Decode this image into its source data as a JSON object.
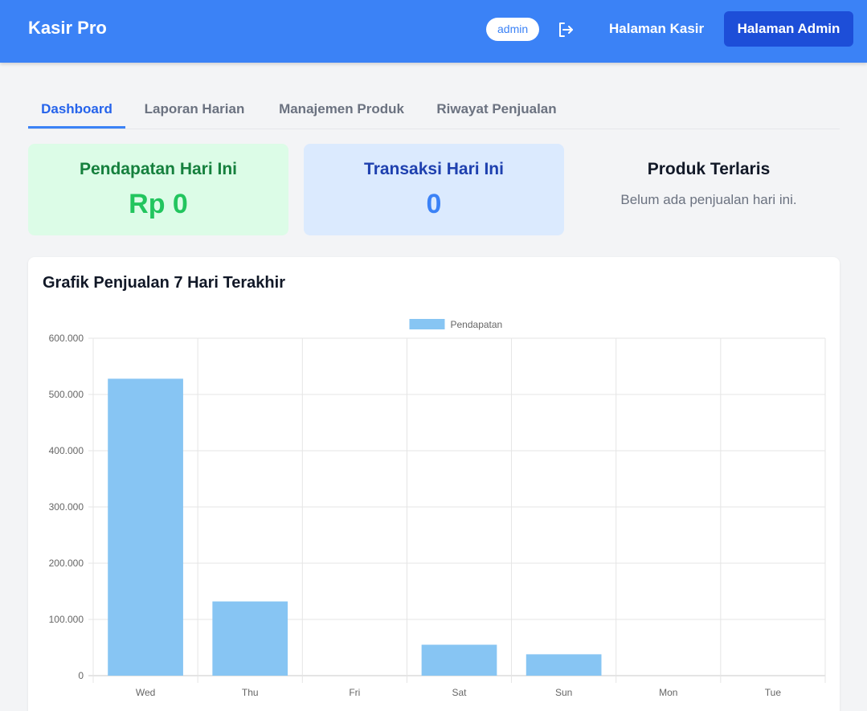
{
  "header": {
    "brand": "Kasir Pro",
    "user": "admin",
    "logout_icon": "logout-icon",
    "nav": [
      "Halaman Kasir",
      "Halaman Admin"
    ],
    "active_nav": "Halaman Admin"
  },
  "tabs": [
    {
      "label": "Dashboard",
      "active": true
    },
    {
      "label": "Laporan Harian",
      "active": false
    },
    {
      "label": "Manajemen Produk",
      "active": false
    },
    {
      "label": "Riwayat Penjualan",
      "active": false
    }
  ],
  "stats": {
    "revenue": {
      "title": "Pendapatan Hari Ini",
      "value": "Rp 0"
    },
    "transactions": {
      "title": "Transaksi Hari Ini",
      "value": "0"
    },
    "top_products": {
      "title": "Produk Terlaris",
      "note": "Belum ada penjualan hari ini."
    }
  },
  "colors": {
    "primary": "#3b82f6",
    "primary_dark": "#1d4ed8",
    "green_bg": "#dcfce7",
    "green_text_title": "#15803d",
    "green_text_value": "#22c55e",
    "blue_bg": "#dbeafe",
    "blue_text_title": "#1e40af",
    "blue_text_value": "#3b82f6",
    "bar": "#87c5f3"
  },
  "chart_card": {
    "title": "Grafik Penjualan 7 Hari Terakhir"
  },
  "chart_data": {
    "type": "bar",
    "categories": [
      "Wed",
      "Thu",
      "Fri",
      "Sat",
      "Sun",
      "Mon",
      "Tue"
    ],
    "series": [
      {
        "name": "Pendapatan",
        "values": [
          528000,
          132000,
          0,
          55000,
          38000,
          0,
          0
        ]
      }
    ],
    "ylim": [
      0,
      600000
    ],
    "yticks": [
      0,
      100000,
      200000,
      300000,
      400000,
      500000,
      600000
    ],
    "ytick_labels": [
      "0",
      "100.000",
      "200.000",
      "300.000",
      "400.000",
      "500.000",
      "600.000"
    ],
    "grid": true,
    "legend": "top-center"
  }
}
